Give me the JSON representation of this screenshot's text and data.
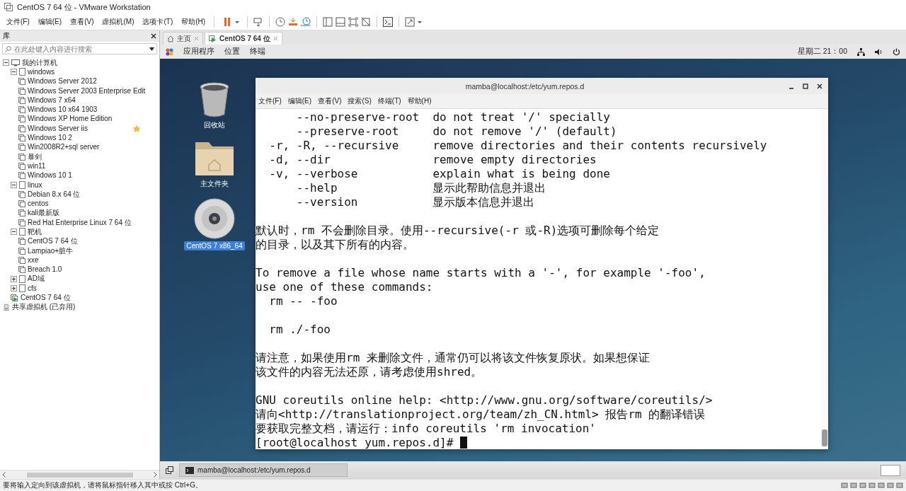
{
  "window": {
    "title": "CentOS 7 64 位 - VMware Workstation"
  },
  "menu": [
    "文件(F)",
    "编辑(E)",
    "查看(V)",
    "虚拟机(M)",
    "选项卡(T)",
    "帮助(H)"
  ],
  "library": {
    "title": "库",
    "search": {
      "placeholder": "在此处键入内容进行搜索"
    },
    "tree": [
      {
        "label": "我的计算机",
        "kind": "computer",
        "expanded": true,
        "children": [
          {
            "label": "windows",
            "kind": "folder",
            "expanded": true,
            "children": [
              {
                "label": "Windows Server 2012",
                "kind": "vm",
                "starred": false
              },
              {
                "label": "Windows Server 2003 Enterprise Edit",
                "kind": "vm",
                "starred": false
              },
              {
                "label": "Windows 7 x64",
                "kind": "vm",
                "starred": false
              },
              {
                "label": "Windows 10 x64 1903",
                "kind": "vm",
                "starred": false
              },
              {
                "label": "Windows XP Home Edition",
                "kind": "vm",
                "starred": false
              },
              {
                "label": "Windows Server iis",
                "kind": "vm",
                "starred": true
              },
              {
                "label": "Windows 10 2",
                "kind": "vm",
                "starred": false
              },
              {
                "label": "Win2008R2+sql server",
                "kind": "vm",
                "starred": false
              },
              {
                "label": "暴剑",
                "kind": "vm",
                "starred": false
              },
              {
                "label": "win11",
                "kind": "vm",
                "starred": false
              },
              {
                "label": "Windows 10 1",
                "kind": "vm",
                "starred": false
              }
            ]
          },
          {
            "label": "linux",
            "kind": "folder",
            "expanded": true,
            "children": [
              {
                "label": "Debian 8.x 64 位",
                "kind": "vm",
                "starred": false
              },
              {
                "label": "centos",
                "kind": "vm",
                "starred": false
              },
              {
                "label": "kali最新版",
                "kind": "vm",
                "starred": false
              },
              {
                "label": "Red Hat Enterprise Linux 7 64 位",
                "kind": "vm",
                "starred": false
              }
            ]
          },
          {
            "label": "靶机",
            "kind": "folder",
            "expanded": true,
            "children": [
              {
                "label": "CentOS 7 64 位",
                "kind": "vm",
                "starred": false
              },
              {
                "label": "Lampiao+脏牛",
                "kind": "vm",
                "starred": false
              },
              {
                "label": "xxe",
                "kind": "vm",
                "starred": false
              },
              {
                "label": "Breach 1.0",
                "kind": "vm",
                "starred": false
              }
            ]
          },
          {
            "label": "AD域",
            "kind": "folder",
            "expanded": false
          },
          {
            "label": "cfs",
            "kind": "folder",
            "expanded": false
          },
          {
            "label": "CentOS 7 64 位",
            "kind": "running-vm"
          }
        ]
      },
      {
        "label": "共享虚拟机 (已弃用)",
        "kind": "shared"
      }
    ]
  },
  "tabs": [
    {
      "label": "主页",
      "kind": "home",
      "selected": false
    },
    {
      "label": "CentOS 7 64 位",
      "kind": "vm",
      "selected": true
    }
  ],
  "guest": {
    "top_bar": {
      "menus": [
        "应用程序",
        "位置",
        "终端"
      ],
      "clock": "星期二 21：00"
    },
    "desktop_icons": [
      {
        "label": "回收站",
        "kind": "trash",
        "selected": false
      },
      {
        "label": "主文件夹",
        "kind": "home-folder",
        "selected": false
      },
      {
        "label": "CentOS 7 x86_64",
        "kind": "disc",
        "selected": true
      }
    ],
    "terminal": {
      "title": "mamba@localhost:/etc/yum.repos.d",
      "menu": [
        "文件(F)",
        "编辑(E)",
        "查看(V)",
        "搜索(S)",
        "终端(T)",
        "帮助(H)"
      ],
      "blocks": [
        [
          "      --no-preserve-root  do not treat '/' specially",
          "      --preserve-root     do not remove '/' (default)",
          "  -r, -R, --recursive     remove directories and their contents recursively",
          "  -d, --dir               remove empty directories",
          "  -v, --verbose           explain what is being done",
          "      --help              显示此帮助信息并退出",
          "      --version           显示版本信息并退出"
        ],
        [
          "默认时，rm 不会删除目录。使用--recursive(-r 或-R)选项可删除每个给定",
          "的目录，以及其下所有的内容。"
        ],
        [
          "To remove a file whose name starts with a '-', for example '-foo',",
          "use one of these commands:",
          "  rm -- -foo"
        ],
        [
          "  rm ./-foo"
        ],
        [
          "请注意，如果使用rm 来删除文件，通常仍可以将该文件恢复原状。如果想保证",
          "该文件的内容无法还原，请考虑使用shred。"
        ],
        [
          "GNU coreutils online help: <http://www.gnu.org/software/coreutils/>",
          "请向<http://translationproject.org/team/zh_CN.html> 报告rm 的翻译错误",
          "要获取完整文档，请运行：info coreutils 'rm invocation'"
        ]
      ],
      "prompt": "[root@localhost yum.repos.d]# "
    },
    "taskbar": {
      "windows": [
        {
          "label": "mamba@localhost:/etc/yum.repos.d"
        }
      ]
    }
  },
  "status_bar": {
    "message": "要将输入定向到该虚拟机，请将鼠标指针移入其中或按 Ctrl+G。"
  }
}
